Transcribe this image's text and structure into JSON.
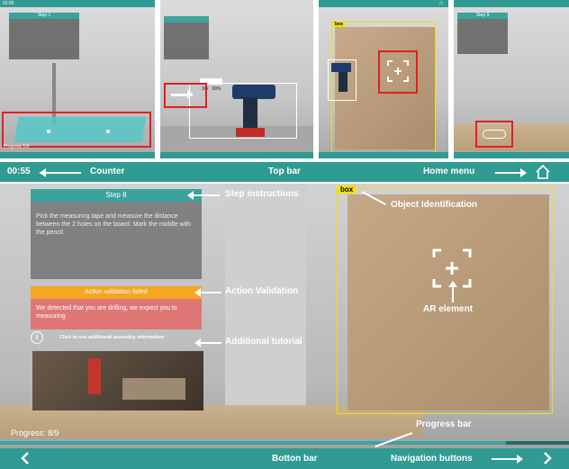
{
  "top_panels": {
    "p1": {
      "status_time": "02:05",
      "step_title": "Step 1",
      "progress_label": "Progress 1/9"
    },
    "p2": {
      "badge_value": "3/4",
      "badge_pct": "99%",
      "small_label": "drill"
    },
    "p3": {
      "tag": "box",
      "drill_tag": "drill"
    },
    "p4": {
      "step_title": "Step 9"
    }
  },
  "strip": {
    "counter_value": "00:55",
    "counter_label": "Counter",
    "top_bar_label": "Top bar",
    "home_menu_label": "Home menu"
  },
  "main": {
    "step_header": "Step 8",
    "step_text": "Pick the measuring tape and measure the distance between the 2 holes on the board. Mark the middle with the pencil.",
    "validation_header": "Action validation failed",
    "validation_text": "We detected that you are drilling, we expect you to measuring",
    "tutorial_text": "Click to see additional assembly information",
    "progress_text": "Progress: 8/9",
    "box_tag": "box"
  },
  "annotations": {
    "step_instructions": "Step instructions",
    "object_identification": "Object Identification",
    "action_validation": "Action Validation",
    "ar_element": "AR element",
    "additional_tutorial": "Additional tutorial",
    "progress_bar": "Progress bar"
  },
  "bottom": {
    "bottom_bar_label": "Botton bar",
    "navigation_label": "Navigation buttons"
  },
  "colors": {
    "teal": "#3aa39d",
    "validation_orange": "#f5a623",
    "validation_red": "#e46a6a",
    "highlight_red": "#e02020",
    "identify_yellow": "#f2e000"
  }
}
